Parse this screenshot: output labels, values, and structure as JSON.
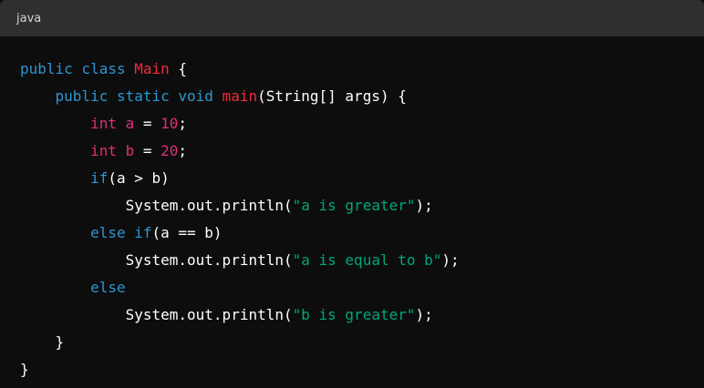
{
  "header": {
    "language": "java"
  },
  "code": {
    "lines": [
      [
        {
          "t": "public class ",
          "c": "kw"
        },
        {
          "t": "Main",
          "c": "tp"
        },
        {
          "t": " {",
          "c": "pl"
        }
      ],
      [
        {
          "t": "    ",
          "c": "pl"
        },
        {
          "t": "public static void ",
          "c": "kw"
        },
        {
          "t": "main",
          "c": "tp"
        },
        {
          "t": "(String[] args) {",
          "c": "pl"
        }
      ],
      [
        {
          "t": "        ",
          "c": "pl"
        },
        {
          "t": "int",
          "c": "vr"
        },
        {
          "t": " ",
          "c": "pl"
        },
        {
          "t": "a",
          "c": "vr"
        },
        {
          "t": " = ",
          "c": "pl"
        },
        {
          "t": "10",
          "c": "nm"
        },
        {
          "t": ";",
          "c": "pl"
        }
      ],
      [
        {
          "t": "        ",
          "c": "pl"
        },
        {
          "t": "int",
          "c": "vr"
        },
        {
          "t": " ",
          "c": "pl"
        },
        {
          "t": "b",
          "c": "vr"
        },
        {
          "t": " = ",
          "c": "pl"
        },
        {
          "t": "20",
          "c": "nm"
        },
        {
          "t": ";",
          "c": "pl"
        }
      ],
      [
        {
          "t": "        ",
          "c": "pl"
        },
        {
          "t": "if",
          "c": "kw"
        },
        {
          "t": "(a > b)",
          "c": "pl"
        }
      ],
      [
        {
          "t": "            System.out.println(",
          "c": "pl"
        },
        {
          "t": "\"a is greater\"",
          "c": "st"
        },
        {
          "t": ");",
          "c": "pl"
        }
      ],
      [
        {
          "t": "        ",
          "c": "pl"
        },
        {
          "t": "else if",
          "c": "kw"
        },
        {
          "t": "(a == b)",
          "c": "pl"
        }
      ],
      [
        {
          "t": "            System.out.println(",
          "c": "pl"
        },
        {
          "t": "\"a is equal to b\"",
          "c": "st"
        },
        {
          "t": ");",
          "c": "pl"
        }
      ],
      [
        {
          "t": "        ",
          "c": "pl"
        },
        {
          "t": "else",
          "c": "kw"
        }
      ],
      [
        {
          "t": "            System.out.println(",
          "c": "pl"
        },
        {
          "t": "\"b is greater\"",
          "c": "st"
        },
        {
          "t": ");",
          "c": "pl"
        }
      ],
      [
        {
          "t": "    }",
          "c": "pl"
        }
      ],
      [
        {
          "t": "}",
          "c": "pl"
        }
      ]
    ]
  },
  "colors": {
    "background": "#0d0d0d",
    "header_background": "#2f2f2f",
    "keyword": "#2e95d3",
    "type_name": "#f22c3d",
    "variable": "#df3079",
    "number": "#df3079",
    "string": "#00a67d",
    "plain": "#ffffff"
  }
}
